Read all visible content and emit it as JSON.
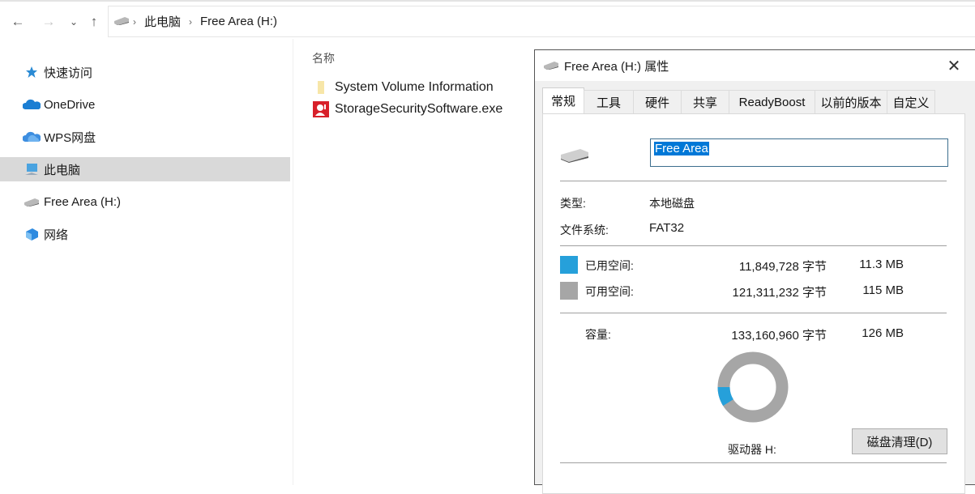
{
  "explorer": {
    "nav": {
      "back": "←",
      "forward": "→",
      "recent": "⌄",
      "up": "↑"
    },
    "breadcrumb": [
      "此电脑",
      "Free Area (H:)"
    ],
    "sidebar": [
      {
        "label": "快速访问",
        "icon": "star-icon"
      },
      {
        "label": "OneDrive",
        "icon": "cloud-icon"
      },
      {
        "label": "WPS网盘",
        "icon": "cloud-icon"
      },
      {
        "label": "此电脑",
        "icon": "computer-icon",
        "selected": true
      },
      {
        "label": "Free Area (H:)",
        "icon": "drive-icon"
      },
      {
        "label": "网络",
        "icon": "network-icon"
      }
    ],
    "column_header": "名称",
    "files": [
      {
        "name": "System Volume Information",
        "icon": "folder-icon"
      },
      {
        "name": "StorageSecuritySoftware.exe",
        "icon": "exe-icon"
      }
    ]
  },
  "dialog": {
    "title": "Free Area (H:) 属性",
    "close": "✕",
    "tabs": [
      "常规",
      "工具",
      "硬件",
      "共享",
      "ReadyBoost",
      "以前的版本",
      "自定义"
    ],
    "active_tab": "常规",
    "volume_name": "Free Area",
    "type_label": "类型:",
    "type_value": "本地磁盘",
    "fs_label": "文件系统:",
    "fs_value": "FAT32",
    "used_label": "已用空间:",
    "used_bytes": "11,849,728 字节",
    "used_size": "11.3 MB",
    "free_label": "可用空间:",
    "free_bytes": "121,311,232 字节",
    "free_size": "115 MB",
    "capacity_label": "容量:",
    "capacity_bytes": "133,160,960 字节",
    "capacity_size": "126 MB",
    "drive_label": "驱动器 H:",
    "cleanup_button": "磁盘清理(D)",
    "colors": {
      "used": "#26a0da",
      "free": "#a6a6a6"
    }
  },
  "chart_data": {
    "type": "pie",
    "title": "驱动器 H:",
    "categories": [
      "已用空间",
      "可用空间"
    ],
    "values": [
      11849728,
      121311232
    ],
    "colors": [
      "#26a0da",
      "#a6a6a6"
    ]
  }
}
